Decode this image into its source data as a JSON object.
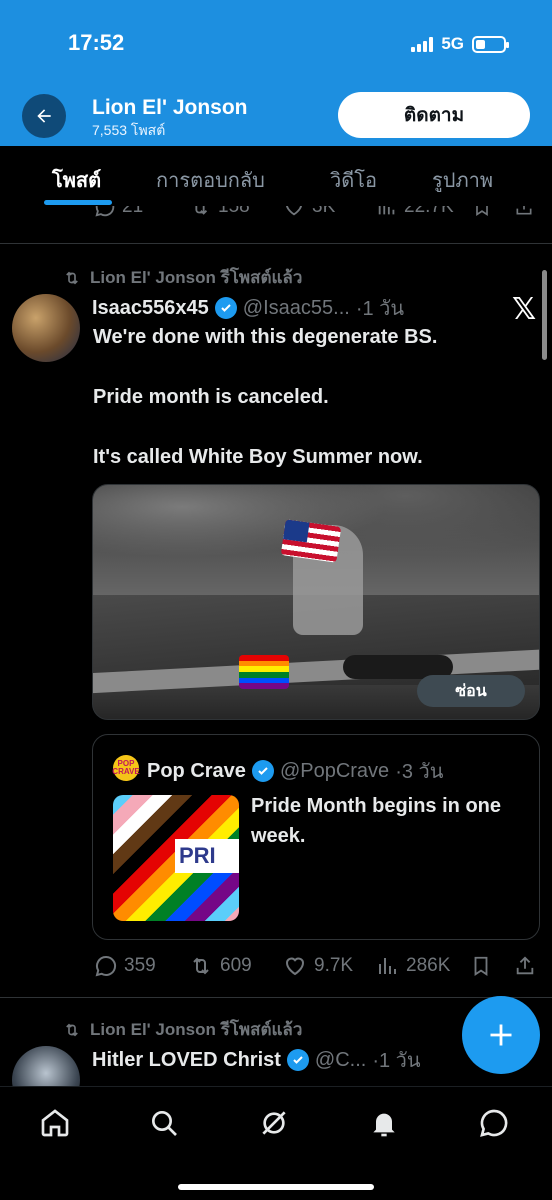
{
  "status_bar": {
    "time": "17:52",
    "network": "5G"
  },
  "header": {
    "name": "Lion El' Jonson",
    "post_count": "7,553 โพสต์",
    "follow_label": "ติดตาม"
  },
  "tabs": [
    {
      "label": "โพสต์",
      "active": true
    },
    {
      "label": "การตอบกลับ",
      "active": false
    },
    {
      "label": "วิดีโอ",
      "active": false
    },
    {
      "label": "รูปภาพ",
      "active": false
    }
  ],
  "prev_tweet_actions": {
    "replies": "21",
    "reposts": "158",
    "likes": "3K",
    "views": "22.7K"
  },
  "tweet1": {
    "repost_label": "Lion El' Jonson รีโพสต์แล้ว",
    "name": "Isaac556x45",
    "handle": "@Isaac55...",
    "time": "·1 วัน",
    "lines": [
      "We're done with this degenerate BS.",
      "Pride month is canceled.",
      "It's called White Boy Summer now."
    ],
    "hide_label": "ซ่อน",
    "quote": {
      "avatar_text": "POP CRAVE",
      "name": "Pop Crave",
      "handle": "@PopCrave",
      "time": "·3 วัน",
      "thumb_text": "PRI",
      "text": "Pride Month begins in one week."
    },
    "actions": {
      "replies": "359",
      "reposts": "609",
      "likes": "9.7K",
      "views": "286K"
    }
  },
  "tweet2": {
    "repost_label": "Lion El' Jonson รีโพสต์แล้ว",
    "name": "Hitler LOVED Christ",
    "handle": "@C...",
    "time": "·1 วัน"
  },
  "icons": {
    "back": "arrow-left-icon",
    "x_logo": "x-logo-icon",
    "fab": "plus-icon",
    "nav": [
      "home-icon",
      "search-icon",
      "grok-icon",
      "bell-icon",
      "message-icon"
    ]
  },
  "colors": {
    "accent": "#1d9bf0",
    "header_bg": "#1d8fe0",
    "background": "#000000",
    "muted": "#71767b"
  }
}
